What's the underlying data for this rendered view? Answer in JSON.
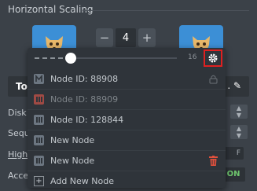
{
  "section": {
    "title": "Horizontal Scaling"
  },
  "stepper": {
    "minus": "−",
    "value": "4",
    "plus": "+"
  },
  "background": {
    "topology_label": "Top",
    "topology_edit_suffix": ". ✎",
    "rows": [
      "Disk l",
      "Sequ",
      "High-",
      "Acces"
    ],
    "toggle_off": "F",
    "toggle_on": "ON"
  },
  "dropdown": {
    "slider_max": "16",
    "slider_value_fraction": 0.25,
    "items": [
      {
        "label": "Node ID: 88908",
        "icon": "master-node-icon",
        "state": "normal",
        "right_icon": "lock-icon"
      },
      {
        "label": "Node ID: 88909",
        "icon": "layer-node-icon",
        "state": "disabled",
        "right_icon": ""
      },
      {
        "label": "Node ID: 128844",
        "icon": "layer-node-icon",
        "state": "normal",
        "right_icon": ""
      },
      {
        "label": "New Node",
        "icon": "layer-node-icon",
        "state": "normal",
        "right_icon": ""
      },
      {
        "label": "New Node",
        "icon": "layer-node-icon",
        "state": "normal",
        "right_icon": "trash-icon"
      }
    ],
    "add_label": "Add New Node"
  },
  "colors": {
    "accent_blue": "#3c8fd6",
    "highlight_red": "#e02020",
    "toggle_on_green": "#6dc36d",
    "trash_red": "#e0503c"
  }
}
